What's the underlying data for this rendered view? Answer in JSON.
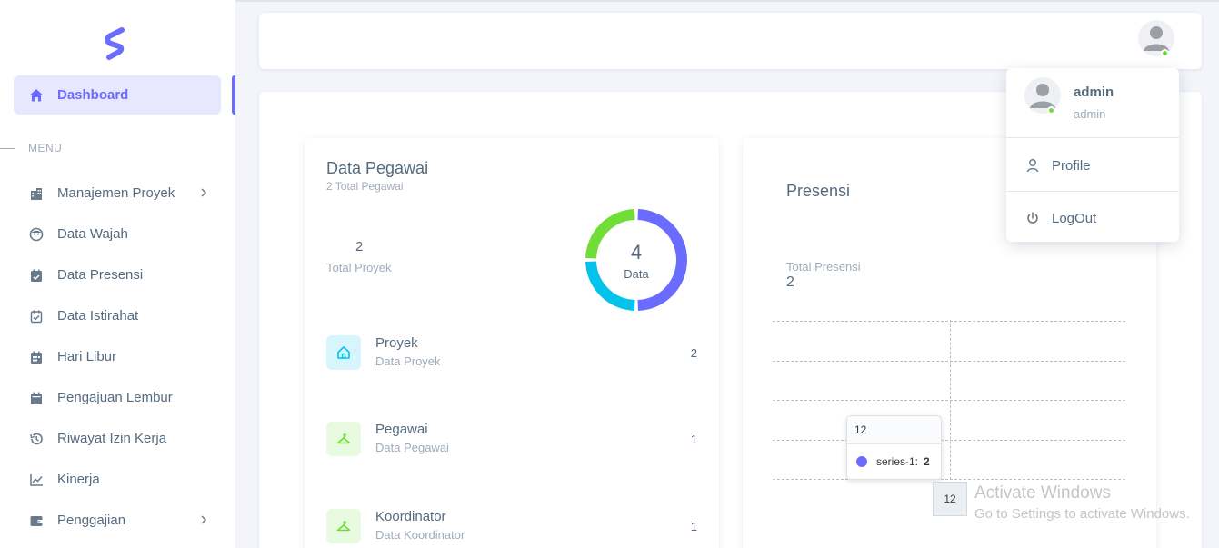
{
  "sidebar": {
    "active": {
      "label": "Dashboard",
      "icon": "home-icon"
    },
    "menu_header": "MENU",
    "items": [
      {
        "label": "Manajemen Proyek",
        "icon": "building-icon",
        "has_chevron": true
      },
      {
        "label": "Data Wajah",
        "icon": "face-icon",
        "has_chevron": false
      },
      {
        "label": "Data Presensi",
        "icon": "calendar-check-icon",
        "has_chevron": false
      },
      {
        "label": "Data Istirahat",
        "icon": "calendar-check-outline-icon",
        "has_chevron": false
      },
      {
        "label": "Hari Libur",
        "icon": "calendar-grid-icon",
        "has_chevron": false
      },
      {
        "label": "Pengajuan Lembur",
        "icon": "calendar-icon",
        "has_chevron": false
      },
      {
        "label": "Riwayat Izin Kerja",
        "icon": "history-icon",
        "has_chevron": false
      },
      {
        "label": "Kinerja",
        "icon": "line-chart-icon",
        "has_chevron": false
      },
      {
        "label": "Penggajian",
        "icon": "wallet-icon",
        "has_chevron": true
      }
    ]
  },
  "pegawai_card": {
    "title": "Data Pegawai",
    "subtitle": "2 Total Pegawai",
    "total_proyek_value": "2",
    "total_proyek_label": "Total Proyek",
    "donut_value": "4",
    "donut_label": "Data",
    "rows": [
      {
        "title": "Proyek",
        "subtitle": "Data Proyek",
        "value": "2",
        "icon": "home-outline-icon",
        "bg": "#d7f5fc",
        "color": "#03c3ec"
      },
      {
        "title": "Pegawai",
        "subtitle": "Data Pegawai",
        "value": "1",
        "icon": "hanger-icon",
        "bg": "#e8fadf",
        "color": "#71dd37"
      },
      {
        "title": "Koordinator",
        "subtitle": "Data Koordinator",
        "value": "1",
        "icon": "hanger-icon",
        "bg": "#e8fadf",
        "color": "#71dd37"
      }
    ]
  },
  "presensi_card": {
    "title": "Presensi",
    "total_label": "Total Presensi",
    "total_value": "2",
    "tooltip": {
      "header": "12",
      "series_name": "series-1:",
      "value": "2"
    },
    "x_label": "12"
  },
  "chart_data": {
    "type": "pie",
    "title": "",
    "center_value": "4",
    "center_label": "Data",
    "slices": [
      {
        "label": "Proyek",
        "value": 2,
        "color": "#696cff"
      },
      {
        "label": "Pegawai",
        "value": 1,
        "color": "#03c3ec"
      },
      {
        "label": "Koordinator",
        "value": 1,
        "color": "#71dd37"
      }
    ]
  },
  "user_menu": {
    "name": "admin",
    "role": "admin",
    "items": [
      {
        "label": "Profile",
        "icon": "user-icon"
      },
      {
        "label": "LogOut",
        "icon": "power-icon"
      }
    ]
  },
  "watermark": {
    "line1": "Activate Windows",
    "line2": "Go to Settings to activate Windows."
  },
  "colors": {
    "primary": "#696cff",
    "info": "#03c3ec",
    "success": "#71dd37"
  }
}
